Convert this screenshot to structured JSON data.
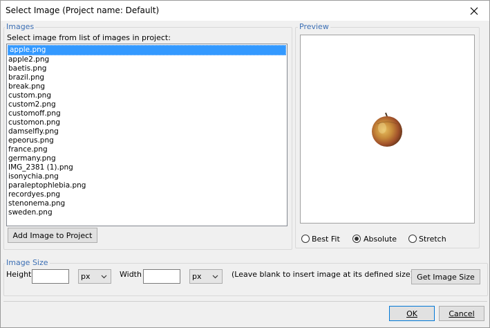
{
  "window": {
    "title": "Select Image (Project name: Default)"
  },
  "images_group": {
    "legend": "Images",
    "instruction": "Select image from list of images in project:",
    "items": [
      "apple.png",
      "apple2.png",
      "baetis.png",
      "brazil.png",
      "break.png",
      "custom.png",
      "custom2.png",
      "customoff.png",
      "customon.png",
      "damselfly.png",
      "epeorus.png",
      "france.png",
      "germany.png",
      "IMG_2381 (1).png",
      "isonychia.png",
      "paraleptophlebia.png",
      "recordyes.png",
      "stenonema.png",
      "sweden.png"
    ],
    "selected_index": 0,
    "add_button": "Add Image to Project"
  },
  "preview_group": {
    "legend": "Preview",
    "options": {
      "best_fit": "Best Fit",
      "absolute": "Absolute",
      "stretch": "Stretch"
    },
    "selected_option": "absolute"
  },
  "size_group": {
    "legend": "Image Size",
    "height_label": "Height",
    "height_value": "",
    "height_unit": "px",
    "width_label": "Width",
    "width_value": "",
    "width_unit": "px",
    "hint": "(Leave blank to insert image at its defined size)",
    "get_size_button": "Get Image Size"
  },
  "footer": {
    "ok": "OK",
    "cancel": "Cancel"
  },
  "colors": {
    "accent": "#3c6fb4",
    "selection": "#3399ff"
  }
}
